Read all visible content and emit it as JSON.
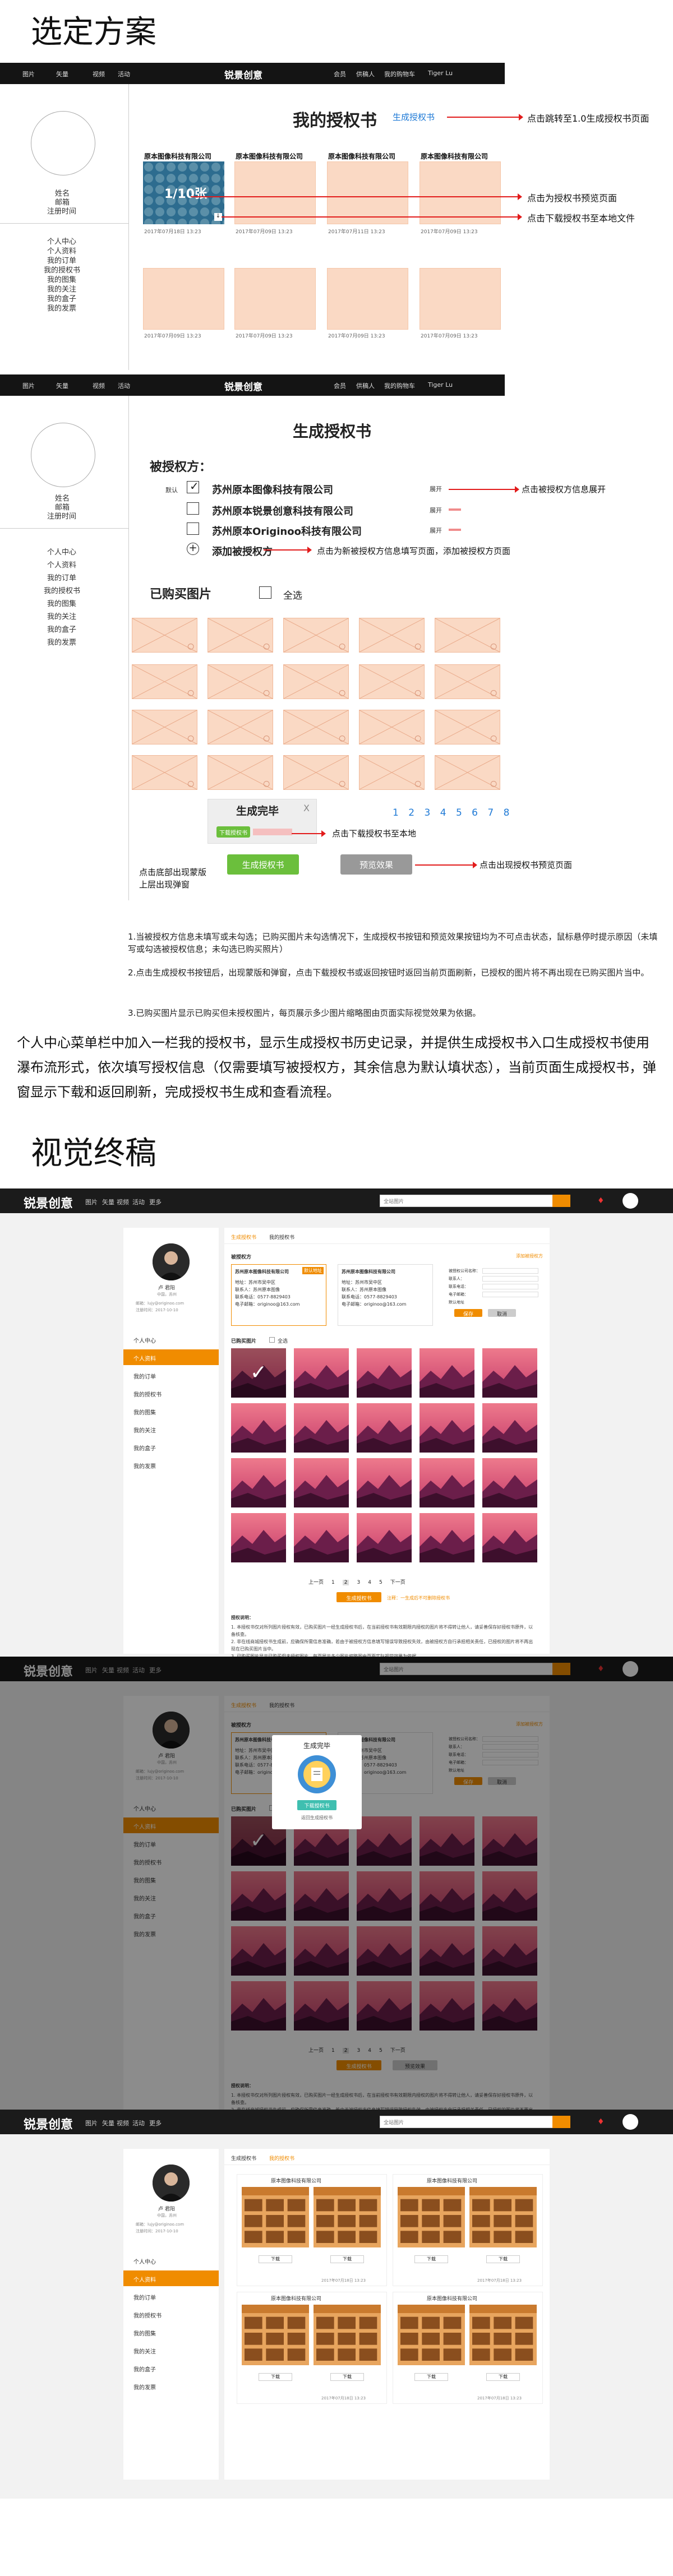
{
  "section1": {
    "heading": "选定方案",
    "nav": {
      "menu": [
        "图片",
        "矢量",
        "视频",
        "活动"
      ],
      "logo": "锐景创意",
      "right": [
        "会员",
        "供稿人",
        "我的购物车",
        "Tiger Lu"
      ]
    },
    "profile": {
      "name": "姓名",
      "email": "邮箱",
      "reg_time": "注册时间"
    },
    "menu": [
      "个人中心",
      "个人资料",
      "我的订单",
      "我的授权书",
      "我的图集",
      "我的关注",
      "我的盒子",
      "我的发票"
    ],
    "page_title": "我的授权书",
    "generate_link": "生成授权书",
    "annotations": [
      "点击跳转至1.0生成授权书页面",
      "点击为授权书预览页面",
      "点击下载授权书至本地文件"
    ],
    "cards_row1": [
      {
        "company": "原本图像科技有限公司",
        "date": "2017年07月18日 13:23"
      },
      {
        "company": "原本图像科技有限公司",
        "date": "2017年07月09日 13:23"
      },
      {
        "company": "原本图像科技有限公司",
        "date": "2017年07月11日 13:23"
      },
      {
        "company": "原本图像科技有限公司",
        "date": "2017年07月09日 13:23"
      }
    ],
    "cards_row2": [
      {
        "date": "2017年07月09日 13:23"
      },
      {
        "date": "2017年07月09日 13:23"
      },
      {
        "date": "2017年07月09日 13:23"
      },
      {
        "date": "2017年07月09日 13:23"
      }
    ],
    "badge": "1/10张"
  },
  "section2": {
    "title": "生成授权书",
    "licensee_label": "被授权方：",
    "default_label": "默认",
    "companies": [
      "苏州原本图像科技有限公司",
      "苏州原本锐景创意科技有限公司",
      "苏州原本Originoo科技有限公司"
    ],
    "expand_label": "展开",
    "add_label": "添加被授权方",
    "annot_expand": "点击被授权方信息展开",
    "annot_add": "点击为新被授权方信息填写页面，添加被授权方页面",
    "purchased_label": "已购买图片",
    "select_all": "全选",
    "popup_title": "生成完毕",
    "popup_close": "X",
    "popup_download": "下载授权书",
    "annot_download": "点击下载授权书至本地",
    "annot_bottom": "点击底部出现蒙版\n上层出现弹窗",
    "generate_btn": "生成授权书",
    "preview_btn": "预览效果",
    "annot_preview": "点击出现授权书预览页面",
    "pages": [
      "1",
      "2",
      "3",
      "4",
      "5",
      "6",
      "7",
      "8"
    ],
    "notes": [
      "1.当被授权方信息未填写或未勾选；已购买图片未勾选情况下，生成授权书按钮和预览效果按钮均为不可点击状态，鼠标悬停时提示原因（未填写或勾选被授权信息；未勾选已购买照片）",
      "2.点击生成授权书按钮后，出现蒙版和弹窗，点击下载授权书或返回按钮时返回当前页面刷新，已授权的图片将不再出现在已购买图片当中。",
      "3.已购买图片显示已购买但未授权图片，每页展示多少图片缩略图由页面实际视觉效果为依据。"
    ]
  },
  "summary": "个人中心菜单栏中加入一栏我的授权书，显示生成授权书历史记录，并提供生成授权书入口生成授权书使用瀑布流形式，依次填写授权信息（仅需要填写被授权方，其余信息为默认填状态），当前页面生成授权书，弹窗显示下载和返回刷新，完成授权书生成和查看流程。",
  "section3": {
    "heading": "视觉终稿",
    "logo": "锐景创意",
    "nav_menu": [
      "图片",
      "矢量",
      "视频",
      "活动",
      "更多"
    ],
    "search_placeholder": "全站图片",
    "user_name": "卢 君阳",
    "user_sub": "中国，苏州",
    "user_email": "邮箱：lujy@originoo.com",
    "user_reg": "注册时间：2017-10-10",
    "menu": [
      "个人中心",
      "个人资料",
      "我的订单",
      "我的授权书",
      "我的图集",
      "我的关注",
      "我的盒子",
      "我的发票"
    ],
    "tabs": [
      "生成授权书",
      "我的授权书"
    ],
    "licensee": "被授权方",
    "add_link": "添加被授权方",
    "info_cards": [
      {
        "title": "苏州原本图像科技有限公司",
        "lines": [
          "地址：苏州市吴中区",
          "联系人：苏州原本图像",
          "联系电话：0577-8829403",
          "电子邮箱：originoo@163.com"
        ],
        "tag": "默认地址"
      },
      {
        "title": "苏州原本图像科技有限公司",
        "lines": [
          "地址：苏州市吴中区",
          "联系人：苏州原本图像",
          "联系电话：0577-8829403",
          "电子邮箱：originoo@163.com"
        ],
        "tag": ""
      }
    ],
    "form_labels": [
      "被授权公司名称：",
      "联系人：",
      "联系电话：",
      "电子邮箱：",
      "默认地址"
    ],
    "form_btns": [
      "保存",
      "取消"
    ],
    "purchased": "已购买图片",
    "select_all": "全选",
    "pager": [
      "上一页",
      "1",
      "2",
      "3",
      "4",
      "5",
      "下一页"
    ],
    "generate_btn": "生成授权书",
    "preview_btn": "预览效果",
    "preview_hint": "注释：一生成后不可删除授权书",
    "notes_title": "授权说明：",
    "notes": [
      "1. 本授权书仅对所列图片授权有效，已购买图片一经生成授权书后，在当前授权书有效期限内授权的图片将不得转让他人，请妥善保存好授权书原件，以备核查。",
      "2. 非在线商城授权书生成前，应确保所需信息准确，若由于被授权方信息填写错误导致授权失效，由被授权方自行承担相关责任，已授权的图片将不再出现在已购买图片当中。",
      "3. 已购买图片显示已购买但未授权图片，每页展示多少图片缩略图由页面实际视觉效果为依据。"
    ],
    "popup_title": "生成完毕",
    "popup_download": "下载授权书",
    "popup_back": "返回生成授权书",
    "cert_company": "原本图像科技有限公司",
    "cert_download": "下载",
    "cert_date": "2017年07月18日 13:23"
  }
}
